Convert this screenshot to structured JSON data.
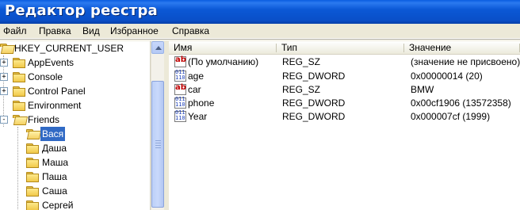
{
  "window": {
    "title": "Редактор реестра"
  },
  "menu": [
    "Файл",
    "Правка",
    "Вид",
    "Избранное",
    "Справка"
  ],
  "tree": {
    "root": "HKEY_CURRENT_USER",
    "items": [
      {
        "label": "AppEvents",
        "expander": "+"
      },
      {
        "label": "Console",
        "expander": "+"
      },
      {
        "label": "Control Panel",
        "expander": "+"
      },
      {
        "label": "Environment",
        "expander": ""
      },
      {
        "label": "Friends",
        "expander": "-"
      }
    ],
    "children": [
      {
        "label": "Вася",
        "selected": true
      },
      {
        "label": "Даша"
      },
      {
        "label": "Маша"
      },
      {
        "label": "Паша"
      },
      {
        "label": "Саша"
      },
      {
        "label": "Сергей"
      }
    ]
  },
  "list": {
    "columns": [
      "Имя",
      "Тип",
      "Значение"
    ],
    "rows": [
      {
        "icon": "string-value-icon",
        "name": "(По умолчанию)",
        "type": "REG_SZ",
        "value": "(значение не присвоено)"
      },
      {
        "icon": "binary-value-icon",
        "name": "age",
        "type": "REG_DWORD",
        "value": "0x00000014 (20)"
      },
      {
        "icon": "string-value-icon",
        "name": "car",
        "type": "REG_SZ",
        "value": "BMW"
      },
      {
        "icon": "binary-value-icon",
        "name": "phone",
        "type": "REG_DWORD",
        "value": "0x00cf1906 (13572358)"
      },
      {
        "icon": "binary-value-icon",
        "name": "Year",
        "type": "REG_DWORD",
        "value": "0x000007cf (1999)"
      }
    ]
  },
  "colors": {
    "titlebar": "#0a4fc8",
    "selection": "#316ac5",
    "chrome": "#ece9d8"
  }
}
